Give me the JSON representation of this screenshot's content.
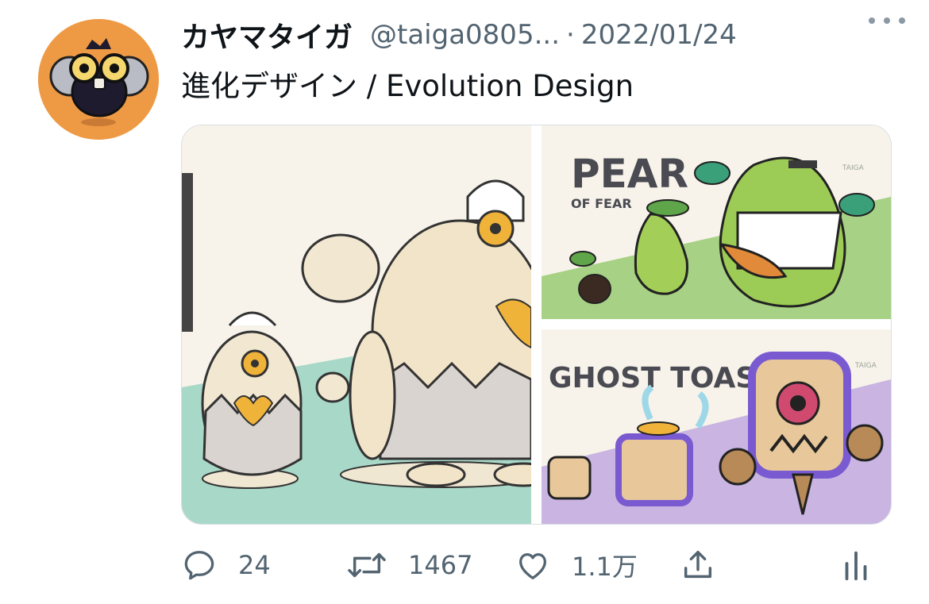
{
  "tweet": {
    "display_name": "カヤマタイガ",
    "handle": "@taiga0805...",
    "separator": "·",
    "date": "2022/01/24",
    "text": "進化デザイン / Evolution Design"
  },
  "media": {
    "panel_pear": {
      "title": "PEAR",
      "subtitle": "OF FEAR",
      "signature": "TAIGA"
    },
    "panel_toast": {
      "title": "GHOST TOAST",
      "signature": "TAIGA"
    }
  },
  "actions": {
    "replies": "24",
    "retweets": "1467",
    "likes": "1.1万"
  },
  "icons": {
    "reply": "speech-bubble-icon",
    "retweet": "retweet-arrows-icon",
    "like": "heart-icon",
    "share": "share-upload-icon",
    "analytics": "bar-chart-icon",
    "more": "more-dots-icon"
  },
  "colors": {
    "avatar_bg": "#ee9a45",
    "secondary_text": "#536471",
    "pear_bg": "#a7d184",
    "toast_bg": "#c9b4e2",
    "egg_bg": "#a8d8c8"
  }
}
